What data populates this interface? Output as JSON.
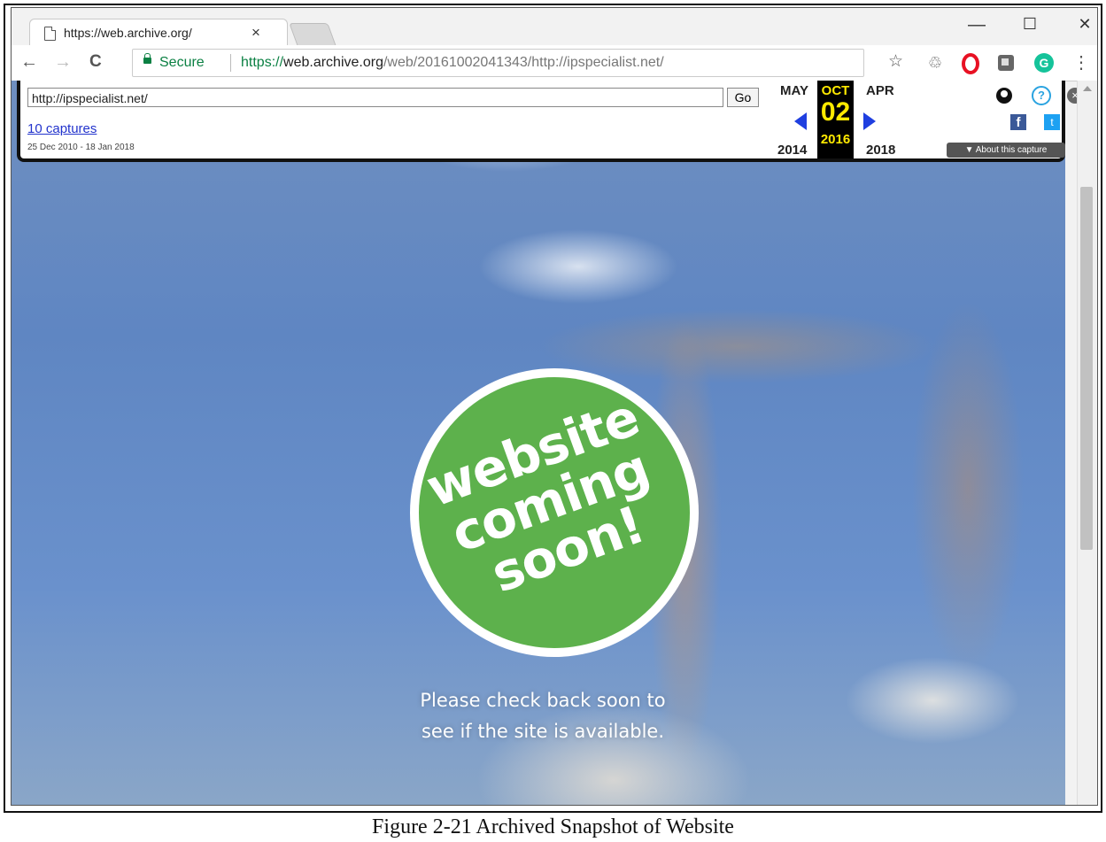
{
  "browser": {
    "tab_title": "https://web.archive.org/",
    "tab_close": "×",
    "window_minimize": "—",
    "window_maximize": "☐",
    "window_close": "✕",
    "back": "←",
    "forward": "→",
    "reload": "C",
    "secure_label": "Secure",
    "url_scheme": "https://",
    "url_host": "web.archive.org",
    "url_path": "/web/20161002041343/http://ipspecialist.net/",
    "bookmark_icon": "☆",
    "menu_icon": "⋮",
    "extension_g": "G",
    "extension_recycle": "♲"
  },
  "wayback": {
    "url_value": "http://ipspecialist.net/",
    "go_label": "Go",
    "captures_label": "10 captures",
    "date_range": "25 Dec 2010 - 18 Jan 2018",
    "prev_month": "MAY",
    "current_month": "OCT",
    "next_month": "APR",
    "current_day": "02",
    "prev_year": "2014",
    "current_year": "2016",
    "next_year": "2018",
    "help_icon": "?",
    "close_icon": "×",
    "facebook_icon": "f",
    "twitter_icon": "t",
    "about_label": "▼ About this capture"
  },
  "page": {
    "badge_lines": [
      "website",
      "coming",
      "soon!"
    ],
    "message_lines": [
      "Please check back soon to",
      "see if the site is available."
    ]
  },
  "caption": "Figure 2-21 Archived Snapshot of Website",
  "colors": {
    "secure_green": "#0b8043",
    "badge_green": "#5db14c",
    "wayback_yellow": "#ffea00",
    "wayback_arrow": "#1f3fe0"
  }
}
